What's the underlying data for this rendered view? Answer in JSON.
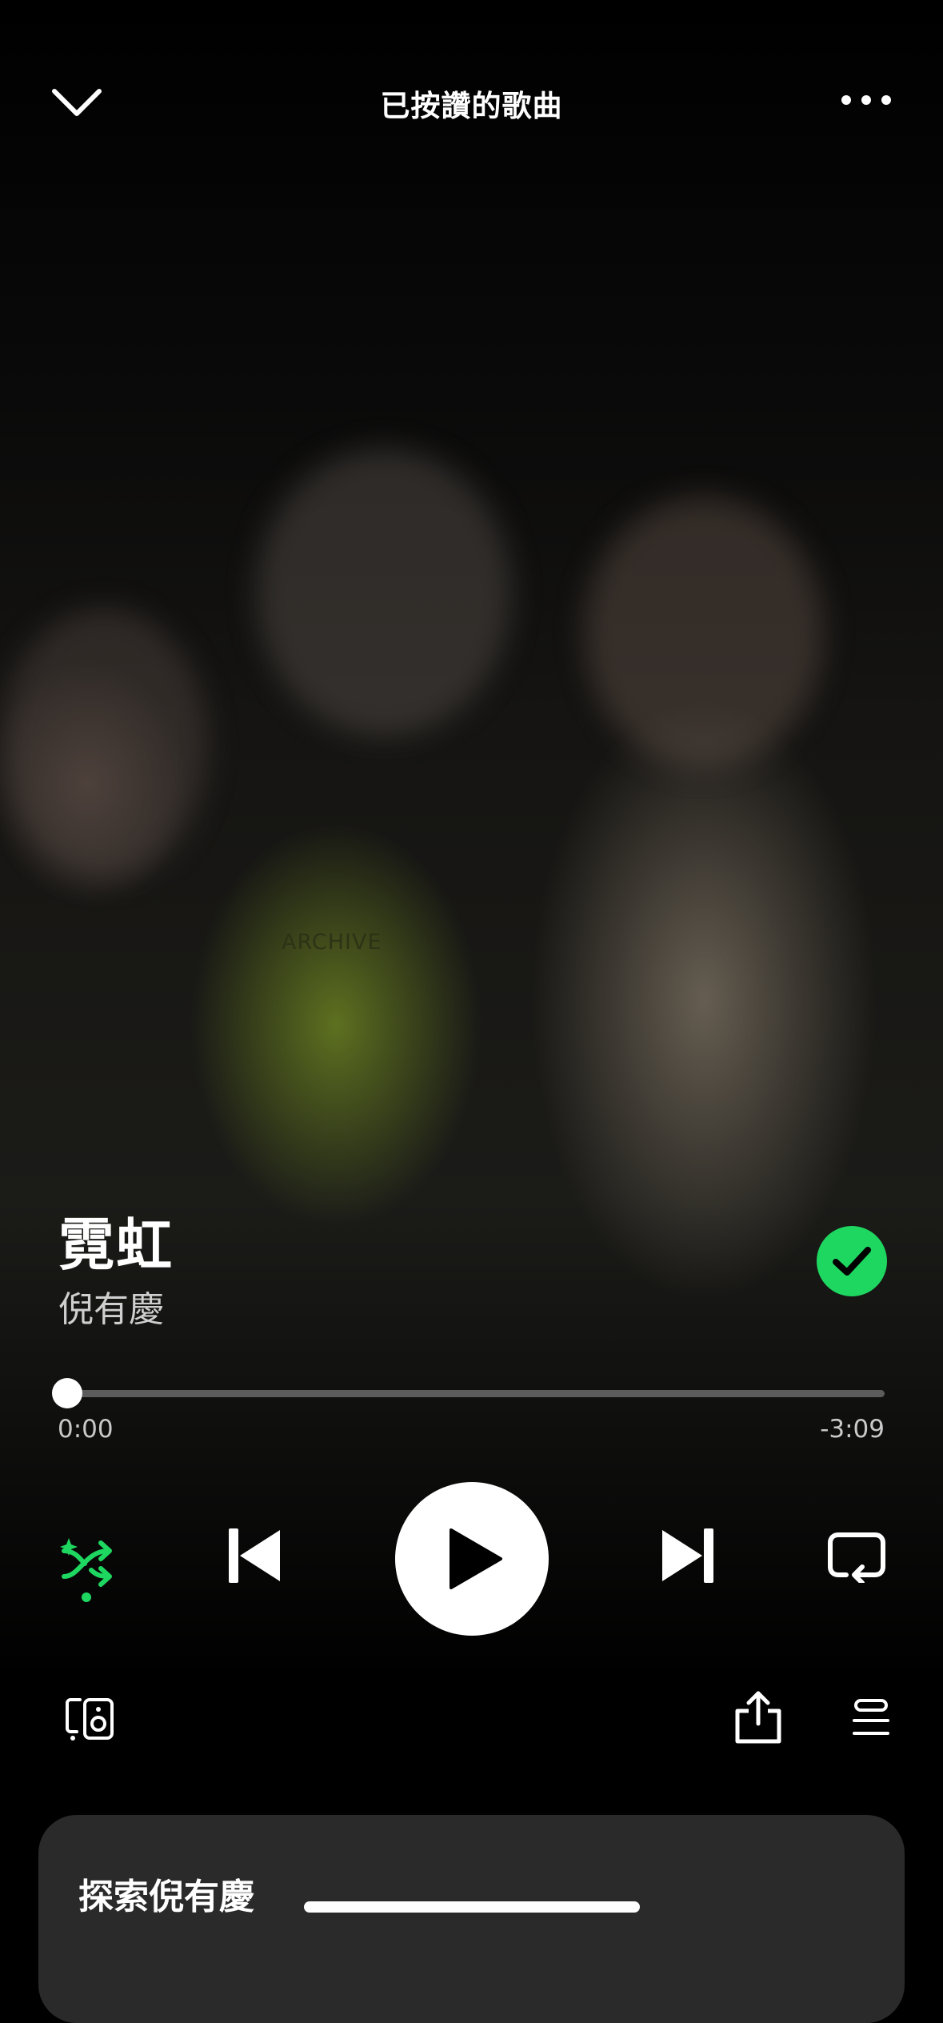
{
  "header": {
    "title": "已按讚的歌曲",
    "collapse_icon": "chevron-down-icon",
    "more_icon": "more-horizontal-icon"
  },
  "artwork": {
    "shirt_text": "ARCHIVE"
  },
  "track": {
    "title": "霓虹",
    "artist": "倪有慶",
    "liked": true
  },
  "progress": {
    "elapsed": "0:00",
    "remaining": "-3:09",
    "fraction": 0.0
  },
  "controls": {
    "shuffle_active": true,
    "state": "paused"
  },
  "bottom": {
    "devices_icon": "connect-device-icon",
    "share_icon": "share-icon",
    "queue_icon": "queue-icon"
  },
  "card": {
    "title": "探索倪有慶"
  },
  "colors": {
    "accent": "#1ed760",
    "background": "#000000",
    "card": "#2a2a2a"
  }
}
